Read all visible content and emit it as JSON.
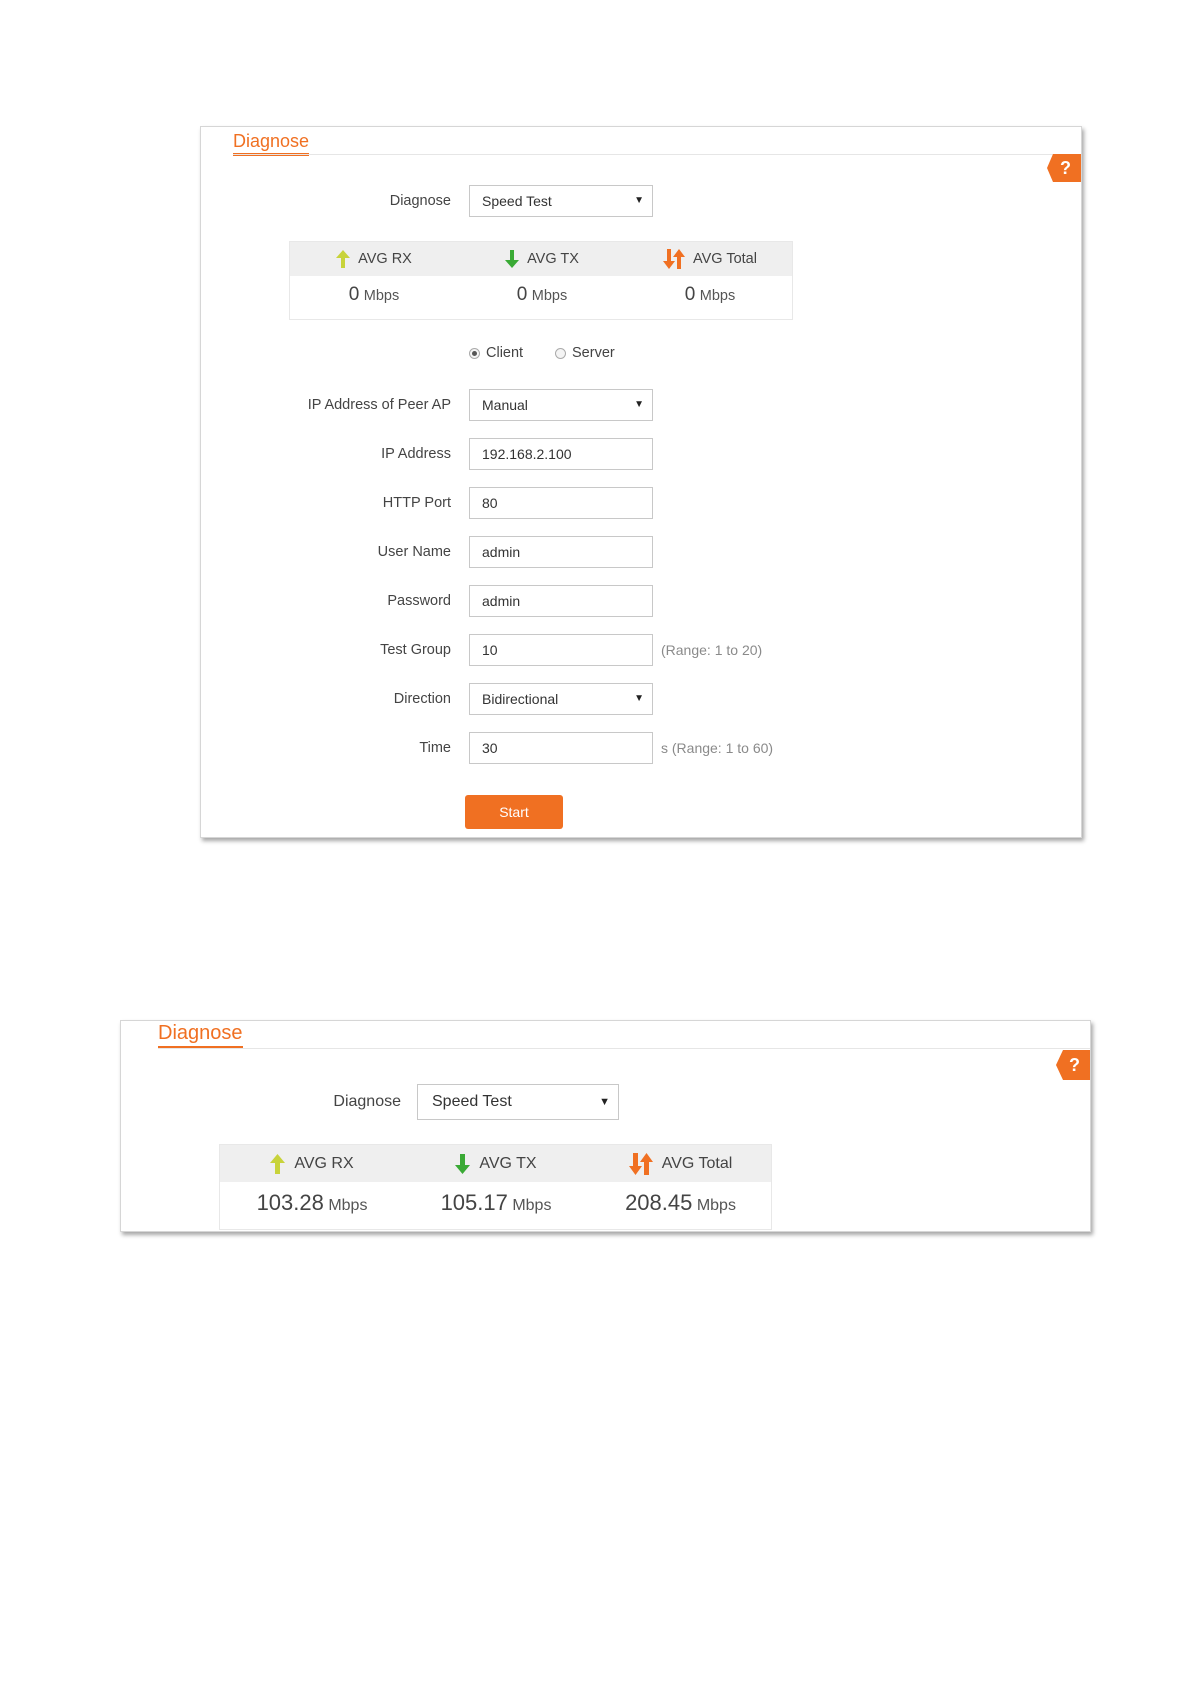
{
  "panel1": {
    "title": "Diagnose",
    "help_label": "?",
    "diagnose_label": "Diagnose",
    "diagnose_value": "Speed Test",
    "stats": {
      "rx_label": "AVG RX",
      "rx_value": "0",
      "rx_unit": "Mbps",
      "tx_label": "AVG TX",
      "tx_value": "0",
      "tx_unit": "Mbps",
      "total_label": "AVG Total",
      "total_value": "0",
      "total_unit": "Mbps"
    },
    "mode_options": [
      {
        "label": "Client",
        "selected": true
      },
      {
        "label": "Server",
        "selected": false
      }
    ],
    "peer_ip_label": "IP Address of Peer AP",
    "peer_ip_value": "Manual",
    "ip_label": "IP Address",
    "ip_value": "192.168.2.100",
    "port_label": "HTTP Port",
    "port_value": "80",
    "username_label": "User Name",
    "username_value": "admin",
    "password_label": "Password",
    "password_value": "admin",
    "group_label": "Test Group",
    "group_value": "10",
    "group_hint": "(Range: 1 to 20)",
    "direction_label": "Direction",
    "direction_value": "Bidirectional",
    "time_label": "Time",
    "time_value": "30",
    "time_hint": "s (Range: 1 to 60)",
    "start_label": "Start"
  },
  "panel2": {
    "title": "Diagnose",
    "help_label": "?",
    "diagnose_label": "Diagnose",
    "diagnose_value": "Speed Test",
    "stats": {
      "rx_label": "AVG RX",
      "rx_value": "103.28",
      "rx_unit": "Mbps",
      "tx_label": "AVG TX",
      "tx_value": "105.17",
      "tx_unit": "Mbps",
      "total_label": "AVG Total",
      "total_value": "208.45",
      "total_unit": "Mbps"
    }
  },
  "colors": {
    "accent": "#f07022",
    "rx_arrow": "#c8d33a",
    "tx_arrow": "#3aaa35",
    "total_arrow": "#f07022"
  }
}
